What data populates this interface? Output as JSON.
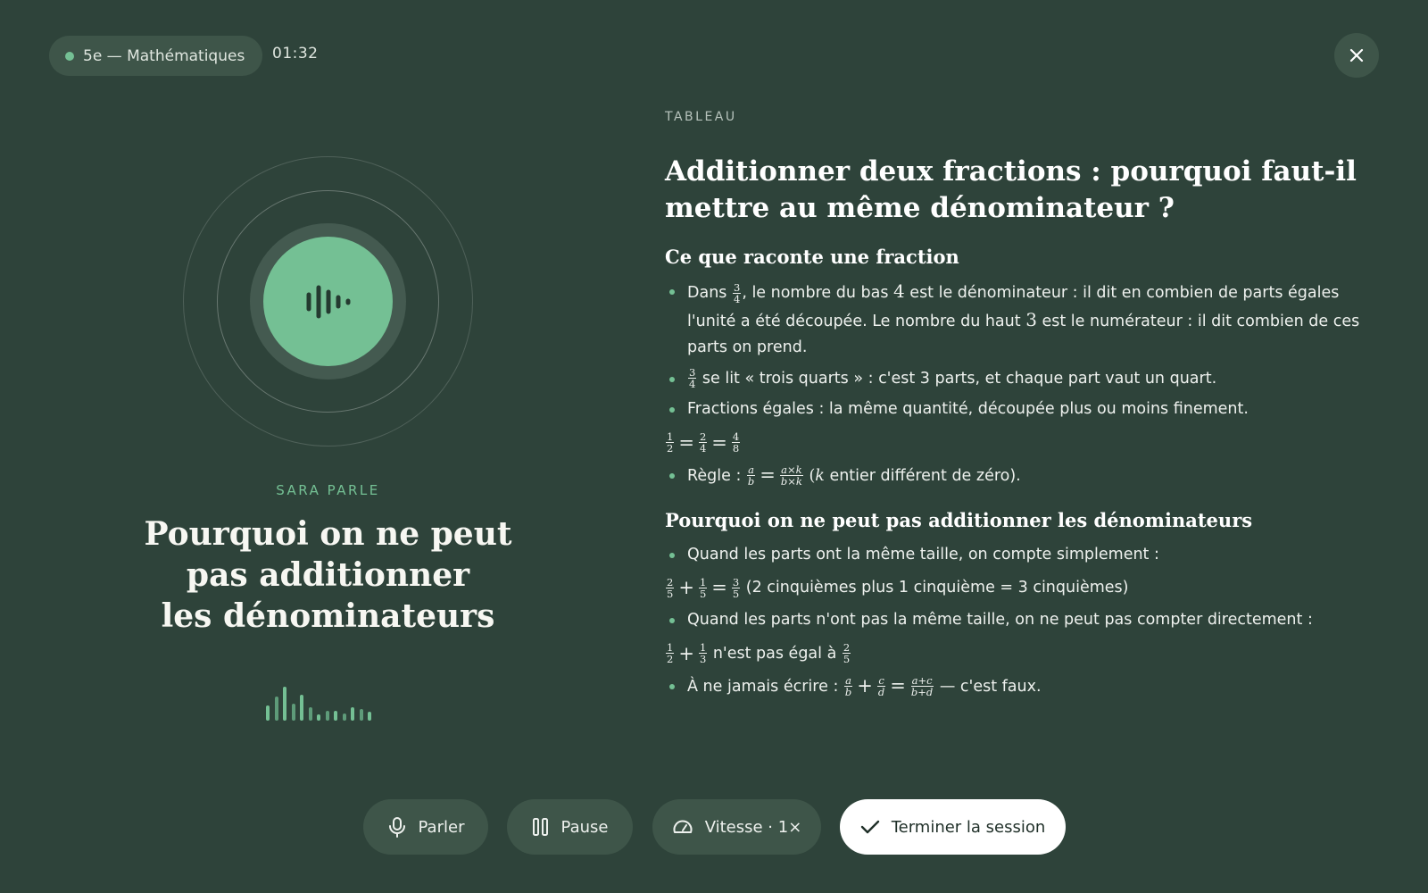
{
  "header": {
    "subject": "5e — Mathématiques",
    "timer": "01:32",
    "close_icon": "close-icon"
  },
  "speaker": {
    "label": "SARA PARLE",
    "utterance_line1": "Pourquoi on ne peut",
    "utterance_line2": "pas additionner",
    "utterance_line3": "les dénominateurs",
    "icon": "voice-wave-icon",
    "levels": [
      0.45,
      0.7,
      1.0,
      0.5,
      0.75,
      0.4,
      0.18,
      0.3,
      0.3,
      0.2,
      0.4,
      0.35,
      0.25
    ]
  },
  "board": {
    "tag": "TABLEAU",
    "title": "Additionner deux fractions : pourquoi faut-il mettre au même dénominateur ?",
    "section1": {
      "heading": "Ce que raconte une fraction",
      "b1_prefix": "Dans ",
      "b1_mid": ", le nombre du bas ",
      "b1_den": "4",
      "b1_text2": " est le dénominateur : il dit en combien de parts égales l'unité a été découpée. Le nombre du haut ",
      "b1_num": "3",
      "b1_text3": " est le numérateur : il dit combien de ces parts on prend.",
      "b2_text": " se lit « trois quarts » : c'est 3 parts, et chaque part vaut un quart.",
      "b3_text": "Fractions égales : la même quantité, découpée plus ou moins finement.",
      "rule_prefix": "Règle : ",
      "rule_suffix": " entier différent de zéro)."
    },
    "section2": {
      "heading": "Pourquoi on ne peut pas additionner les dénominateurs",
      "b1_text": "Quand les parts ont la même taille, on compte simplement :",
      "eq2_comment": " (2 cinquièmes plus 1 cinquième = 3 cinquièmes)",
      "b2_text": "Quand les parts n'ont pas la même taille, on ne peut pas compter directement :",
      "eq3_text": " n'est pas égal à ",
      "b3_prefix": "À ne jamais écrire : ",
      "b3_suffix": " — c'est faux."
    }
  },
  "controls": {
    "talk_label": "Parler",
    "pause_label": "Pause",
    "speed_label": "Vitesse · 1×",
    "finish_label": "Terminer la session"
  },
  "colors": {
    "background": "#2e433a",
    "accent": "#74c094",
    "pill": "#3e5549"
  }
}
